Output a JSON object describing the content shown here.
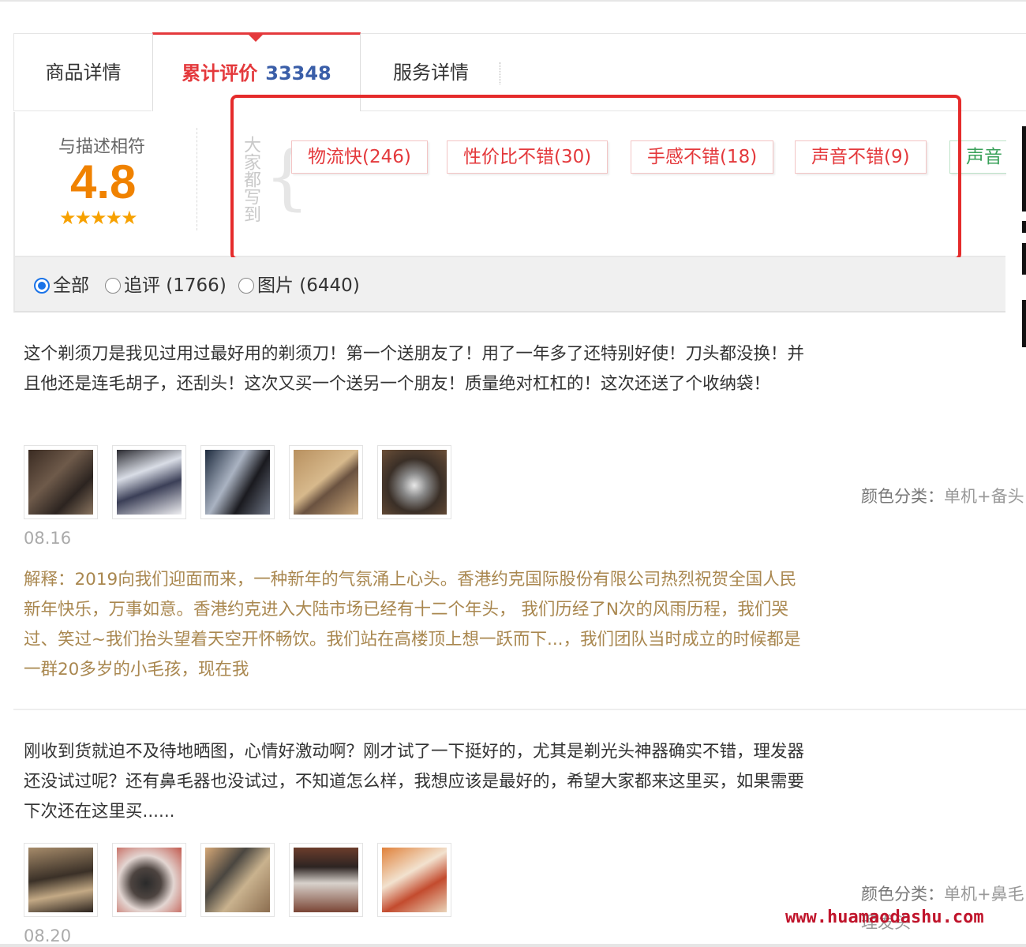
{
  "tabs": {
    "detail": "商品详情",
    "reviews_label": "累计评价",
    "reviews_count": "33348",
    "service": "服务详情"
  },
  "rating": {
    "label": "与描述相符",
    "score": "4.8",
    "stars": "★★★★★"
  },
  "tag_intro": "大家都写到",
  "tags": [
    "物流快(246)",
    "性价比不错(30)",
    "手感不错(18)",
    "声音不错(9)",
    "声音"
  ],
  "filters": [
    {
      "label": "全部",
      "selected": true
    },
    {
      "label": "追评 (1766)",
      "selected": false
    },
    {
      "label": "图片 (6440)",
      "selected": false
    }
  ],
  "reviews": [
    {
      "text": "这个剃须刀是我见过用过最好用的剃须刀！第一个送朋友了！用了一年多了还特别好使！刀头都没换！并且他还是连毛胡子，还刮头！这次又买一个送另一个朋友！质量绝对杠杠的！这次还送了个收纳袋！",
      "date": "08.16",
      "reply": "解释：2019向我们迎面而来，一种新年的气氛涌上心头。香港约克国际股份有限公司热烈祝贺全国人民新年快乐，万事如意。香港约克进入大陆市场已经有十二个年头， 我们历经了N次的风雨历程，我们哭过、笑过~我们抬头望着天空开怀畅饮。我们站在高楼顶上想一跃而下...，我们团队当时成立的时候都是一群20多岁的小毛孩，现在我",
      "sku_label": "颜色分类：",
      "sku_value": "单机+备头"
    },
    {
      "text": "刚收到货就迫不及待地晒图，心情好激动啊？刚才试了一下挺好的，尤其是剃光头神器确实不错，理发器还没试过呢？还有鼻毛器也没试过，不知道怎么样，我想应该是最好的，希望大家都来这里买，如果需要下次还在这里买......",
      "date": "08.20",
      "sku_label": "颜色分类：",
      "sku_value": "单机+鼻毛理发头"
    }
  ],
  "watermark": "www.huamaodashu.com"
}
